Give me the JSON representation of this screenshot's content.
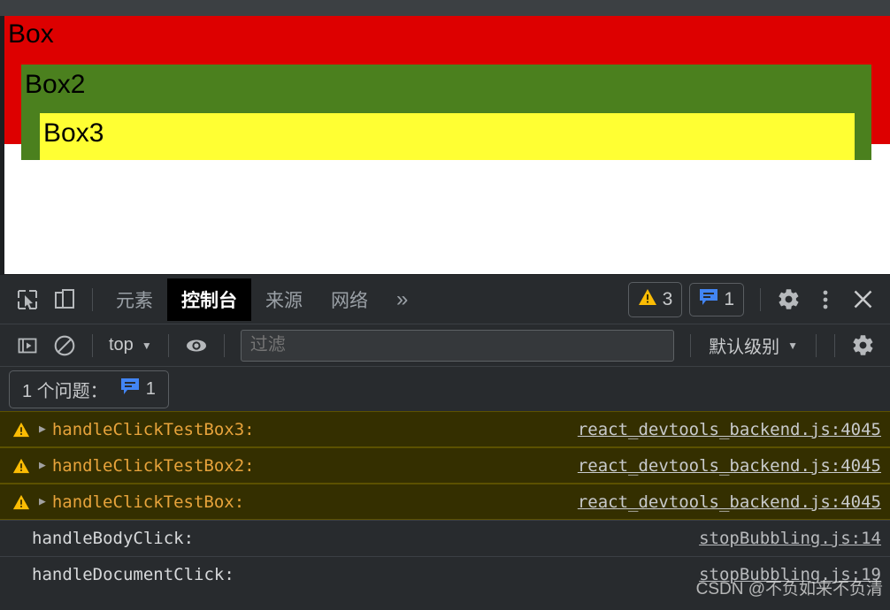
{
  "page": {
    "boxes": [
      {
        "label": "Box",
        "color": "#dd0000"
      },
      {
        "label": "Box2",
        "color": "#4b801e"
      },
      {
        "label": "Box3",
        "color": "#ffff33"
      }
    ]
  },
  "devtools": {
    "icons": {
      "inspect": "inspect-element-icon",
      "device": "device-toolbar-icon",
      "settings": "gear-icon",
      "more": "more-options-icon",
      "close": "close-icon"
    },
    "tabs": [
      {
        "label": "元素",
        "active": false
      },
      {
        "label": "控制台",
        "active": true
      },
      {
        "label": "来源",
        "active": false
      },
      {
        "label": "网络",
        "active": false
      }
    ],
    "more_tabs": "»",
    "counters": {
      "warnings": "3",
      "messages": "1"
    },
    "filterbar": {
      "context": "top",
      "caret": "▼",
      "filter_placeholder": "过滤",
      "filter_value": "",
      "levels": "默认级别"
    },
    "issues": {
      "label": "1 个问题：",
      "count": "1"
    },
    "messages": [
      {
        "level": "warning",
        "expandable": true,
        "text": "handleClickTestBox3:",
        "source": "react_devtools_backend.js:4045"
      },
      {
        "level": "warning",
        "expandable": true,
        "text": "handleClickTestBox2:",
        "source": "react_devtools_backend.js:4045"
      },
      {
        "level": "warning",
        "expandable": true,
        "text": "handleClickTestBox:",
        "source": "react_devtools_backend.js:4045"
      },
      {
        "level": "log",
        "expandable": false,
        "text": "handleBodyClick:",
        "source": "stopBubbling.js:14"
      },
      {
        "level": "log",
        "expandable": false,
        "text": "handleDocumentClick:",
        "source": "stopBubbling.js:19"
      }
    ]
  },
  "watermark": "CSDN @不负如来不负清"
}
